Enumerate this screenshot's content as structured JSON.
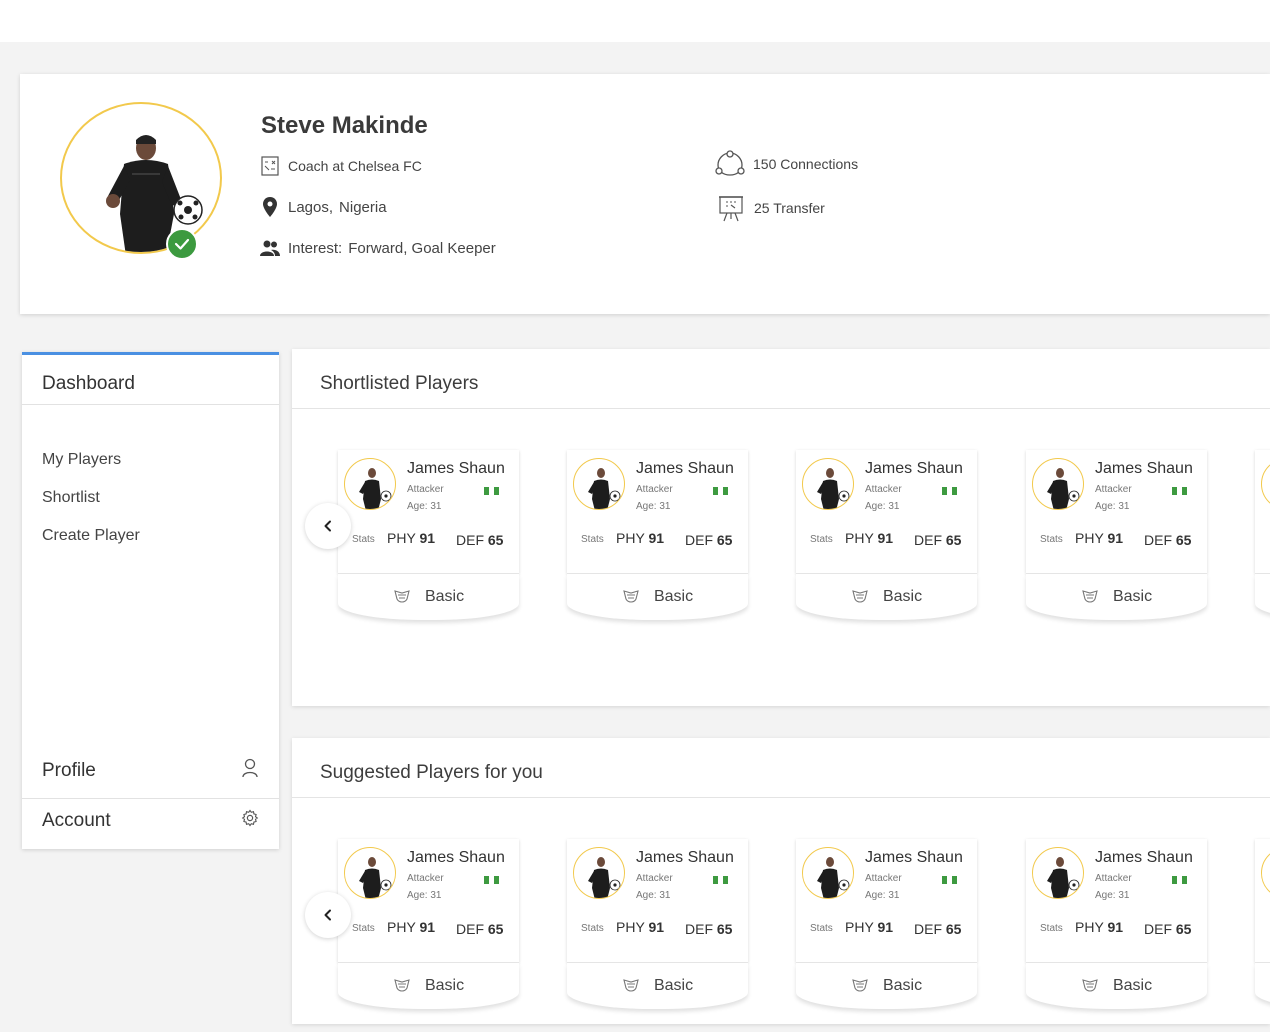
{
  "profile": {
    "name": "Steve Makinde",
    "role": "Coach at Chelsea FC",
    "city": "Lagos,",
    "country": "Nigeria",
    "interest_label": "Interest:",
    "interest_value": "Forward, Goal Keeper",
    "connections": "150 Connections",
    "transfers": "25 Transfer"
  },
  "sidebar": {
    "title": "Dashboard",
    "items": [
      {
        "label": "My Players"
      },
      {
        "label": "Shortlist"
      },
      {
        "label": "Create Player"
      }
    ],
    "profile_label": "Profile",
    "account_label": "Account"
  },
  "shortlisted": {
    "title": "Shortlisted Players",
    "cards": [
      {
        "name": "James Shaun",
        "role": "Attacker",
        "age": "Age: 31",
        "stats_label": "Stats",
        "phy_label": "PHY",
        "phy": "91",
        "def_label": "DEF",
        "def": "65",
        "tier": "Basic"
      },
      {
        "name": "James Shaun",
        "role": "Attacker",
        "age": "Age: 31",
        "stats_label": "Stats",
        "phy_label": "PHY",
        "phy": "91",
        "def_label": "DEF",
        "def": "65",
        "tier": "Basic"
      },
      {
        "name": "James Shaun",
        "role": "Attacker",
        "age": "Age: 31",
        "stats_label": "Stats",
        "phy_label": "PHY",
        "phy": "91",
        "def_label": "DEF",
        "def": "65",
        "tier": "Basic"
      },
      {
        "name": "James Shaun",
        "role": "Attacker",
        "age": "Age: 31",
        "stats_label": "Stats",
        "phy_label": "PHY",
        "phy": "91",
        "def_label": "DEF",
        "def": "65",
        "tier": "Basic"
      }
    ]
  },
  "suggested": {
    "title": "Suggested Players for you",
    "cards": [
      {
        "name": "James Shaun",
        "role": "Attacker",
        "age": "Age: 31",
        "stats_label": "Stats",
        "phy_label": "PHY",
        "phy": "91",
        "def_label": "DEF",
        "def": "65",
        "tier": "Basic"
      },
      {
        "name": "James Shaun",
        "role": "Attacker",
        "age": "Age: 31",
        "stats_label": "Stats",
        "phy_label": "PHY",
        "phy": "91",
        "def_label": "DEF",
        "def": "65",
        "tier": "Basic"
      },
      {
        "name": "James Shaun",
        "role": "Attacker",
        "age": "Age: 31",
        "stats_label": "Stats",
        "phy_label": "PHY",
        "phy": "91",
        "def_label": "DEF",
        "def": "65",
        "tier": "Basic"
      },
      {
        "name": "James Shaun",
        "role": "Attacker",
        "age": "Age: 31",
        "stats_label": "Stats",
        "phy_label": "PHY",
        "phy": "91",
        "def_label": "DEF",
        "def": "65",
        "tier": "Basic"
      }
    ]
  },
  "colors": {
    "accent": "#4a90e2",
    "ring": "#f2c94c",
    "verified": "#3c9a3f",
    "flag_green": "#3d9a40"
  },
  "icons": {
    "verified": "check-icon",
    "role": "tactics-board-icon",
    "location": "map-pin-icon",
    "interest": "people-icon",
    "connections": "network-icon",
    "transfers": "presentation-board-icon",
    "profile": "user-icon",
    "account": "gear-icon",
    "carousel_prev": "chevron-left-icon",
    "tier": "badge-icon",
    "flag": "nigeria-flag-icon"
  }
}
